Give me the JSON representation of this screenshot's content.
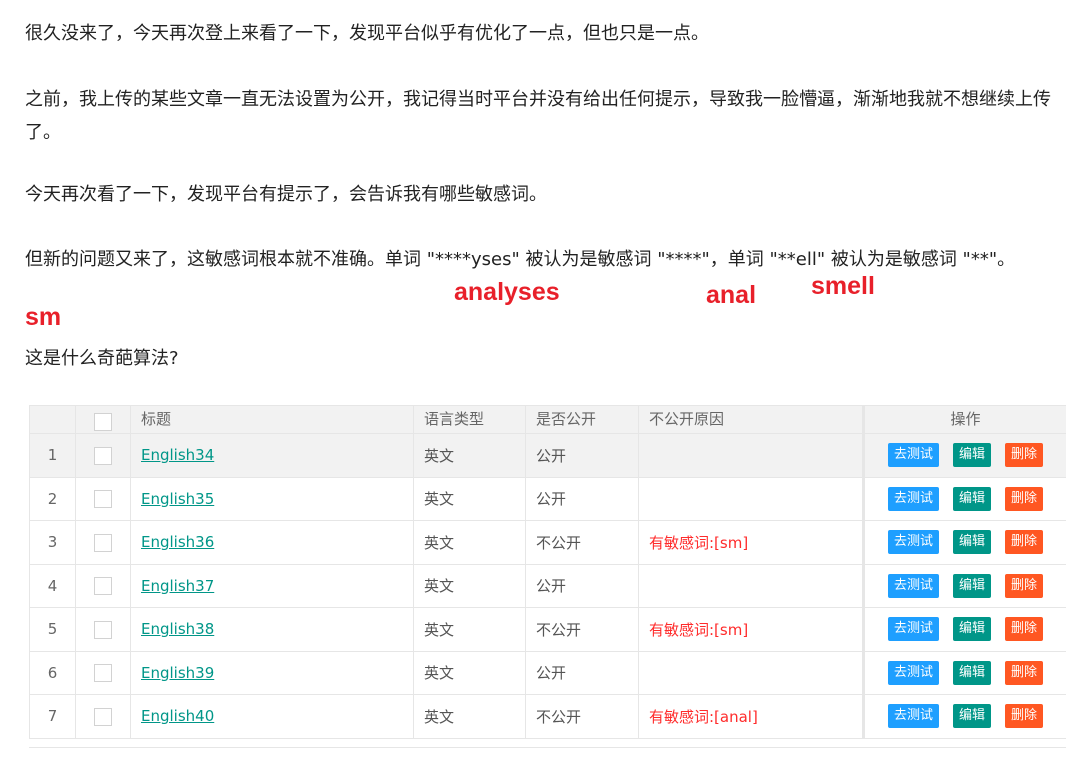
{
  "paragraphs": [
    "很久没来了，今天再次登上来看了一下，发现平台似乎有优化了一点，但也只是一点。",
    "之前，我上传的某些文章一直无法设置为公开，我记得当时平台并没有给出任何提示，导致我一脸懵逼，渐渐地我就不想继续上传了。",
    "今天再次看了一下，发现平台有提示了，会告诉我有哪些敏感词。",
    "但新的问题又来了，这敏感词根本就不准确。单词 \"****yses\" 被认为是敏感词 \"****\"，单词 \"**ell\" 被认为是敏感词 \"**\"。",
    "这是什么奇葩算法?"
  ],
  "annotations": {
    "analyses": "analyses",
    "anal": "anal",
    "smell": "smell",
    "sm": "sm"
  },
  "table": {
    "headers": {
      "title": "标题",
      "language": "语言类型",
      "public": "是否公开",
      "reason": "不公开原因",
      "actions": "操作"
    },
    "buttons": {
      "test": "去测试",
      "edit": "编辑",
      "delete": "删除"
    },
    "rows": [
      {
        "num": "1",
        "title": "English34",
        "language": "英文",
        "public": "公开",
        "reason": ""
      },
      {
        "num": "2",
        "title": "English35",
        "language": "英文",
        "public": "公开",
        "reason": ""
      },
      {
        "num": "3",
        "title": "English36",
        "language": "英文",
        "public": "不公开",
        "reason": "有敏感词:[sm]"
      },
      {
        "num": "4",
        "title": "English37",
        "language": "英文",
        "public": "公开",
        "reason": ""
      },
      {
        "num": "5",
        "title": "English38",
        "language": "英文",
        "public": "不公开",
        "reason": "有敏感词:[sm]"
      },
      {
        "num": "6",
        "title": "English39",
        "language": "英文",
        "public": "公开",
        "reason": ""
      },
      {
        "num": "7",
        "title": "English40",
        "language": "英文",
        "public": "不公开",
        "reason": "有敏感词:[anal]"
      }
    ]
  },
  "colors": {
    "accent_teal": "#009688",
    "button_blue": "#1e9fff",
    "button_orange": "#ff5722",
    "warning_red": "#ff2b2b",
    "annotation_red": "#e8202a"
  }
}
